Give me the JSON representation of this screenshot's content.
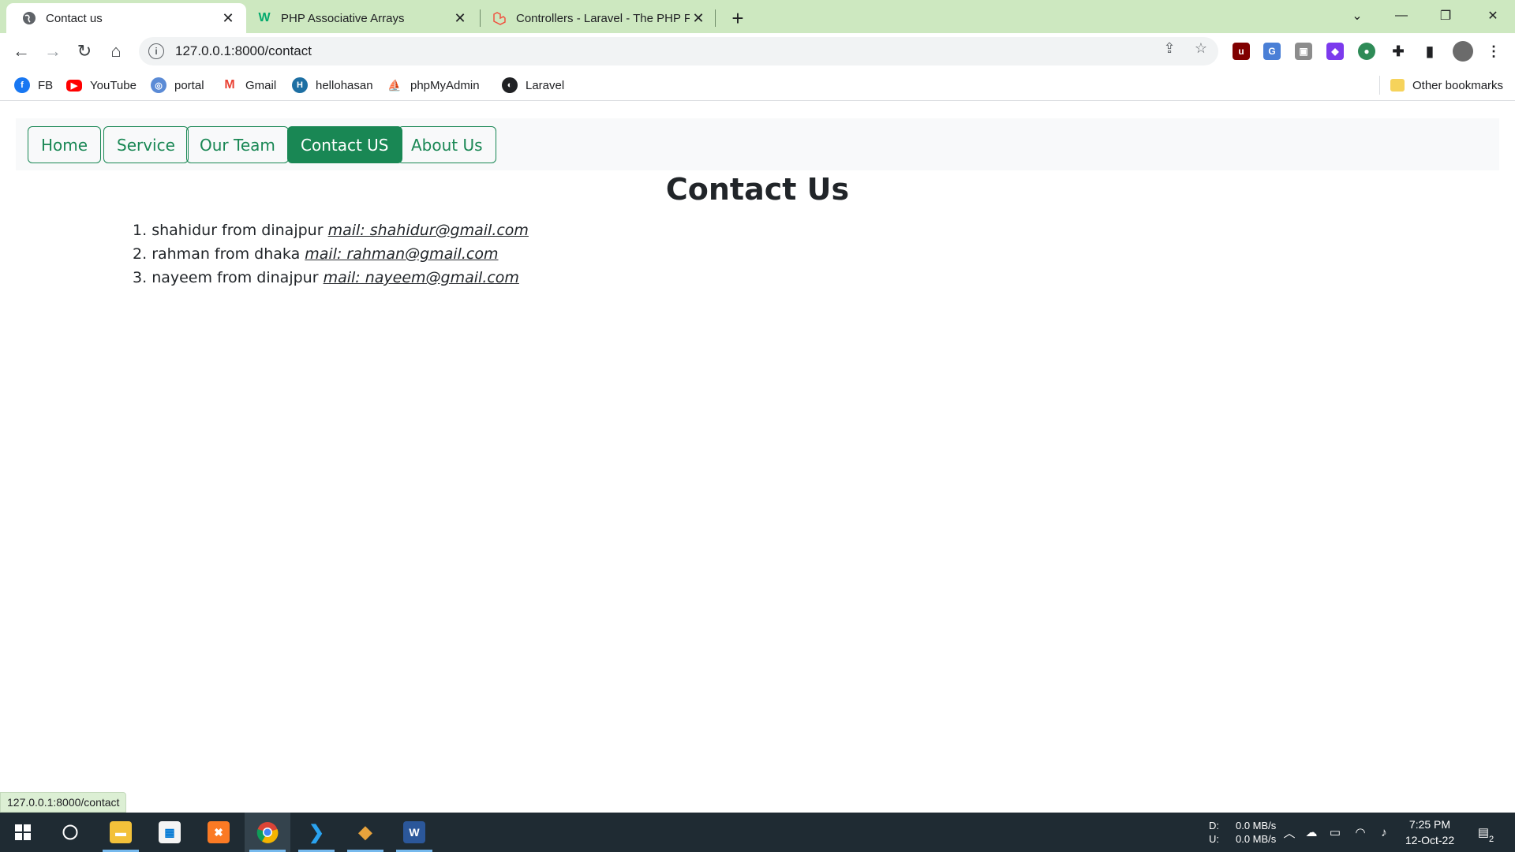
{
  "tabs": [
    {
      "title": "Contact us",
      "favicon": "globe-icon"
    },
    {
      "title": "PHP Associative Arrays",
      "favicon": "w3schools-icon"
    },
    {
      "title": "Controllers - Laravel - The PHP Fr",
      "favicon": "laravel-icon"
    }
  ],
  "toolbar": {
    "url": "127.0.0.1:8000/contact"
  },
  "bookmarks": [
    {
      "label": "FB",
      "icon": "facebook-icon",
      "color": "#1877f2"
    },
    {
      "label": "YouTube",
      "icon": "youtube-icon",
      "color": "#ff0000"
    },
    {
      "label": "portal",
      "icon": "portal-icon",
      "color": "#5b8bd6"
    },
    {
      "label": "Gmail",
      "icon": "gmail-icon",
      "color": "#ea4335"
    },
    {
      "label": "hellohasan",
      "icon": "hellohasan-icon",
      "color": "#1d6fa3"
    },
    {
      "label": "phpMyAdmin",
      "icon": "phpmyadmin-icon",
      "color": "#f29111"
    },
    {
      "label": "Laravel",
      "icon": "globe-icon",
      "color": "#202124"
    }
  ],
  "other_bookmarks": "Other bookmarks",
  "page": {
    "nav": [
      {
        "label": "Home",
        "active": false
      },
      {
        "label": "Service",
        "active": false
      },
      {
        "label": "Our Team",
        "active": false
      },
      {
        "label": "Contact US",
        "active": true
      },
      {
        "label": "About Us",
        "active": false
      }
    ],
    "title": "Contact Us",
    "contacts": [
      {
        "num": "1.",
        "text": "shahidur from dinajpur",
        "mail": "mail: shahidur@gmail.com"
      },
      {
        "num": "2.",
        "text": "rahman from dhaka",
        "mail": "mail: rahman@gmail.com"
      },
      {
        "num": "3.",
        "text": "nayeem from dinajpur",
        "mail": "mail: nayeem@gmail.com"
      }
    ],
    "accent": "#198754"
  },
  "status_url": "127.0.0.1:8000/contact",
  "taskbar": {
    "net_down_label": "D:",
    "net_down": "0.0 MB/s",
    "net_up_label": "U:",
    "net_up": "0.0 MB/s",
    "time": "7:25 PM",
    "date": "12-Oct-22",
    "notifications": "2"
  }
}
